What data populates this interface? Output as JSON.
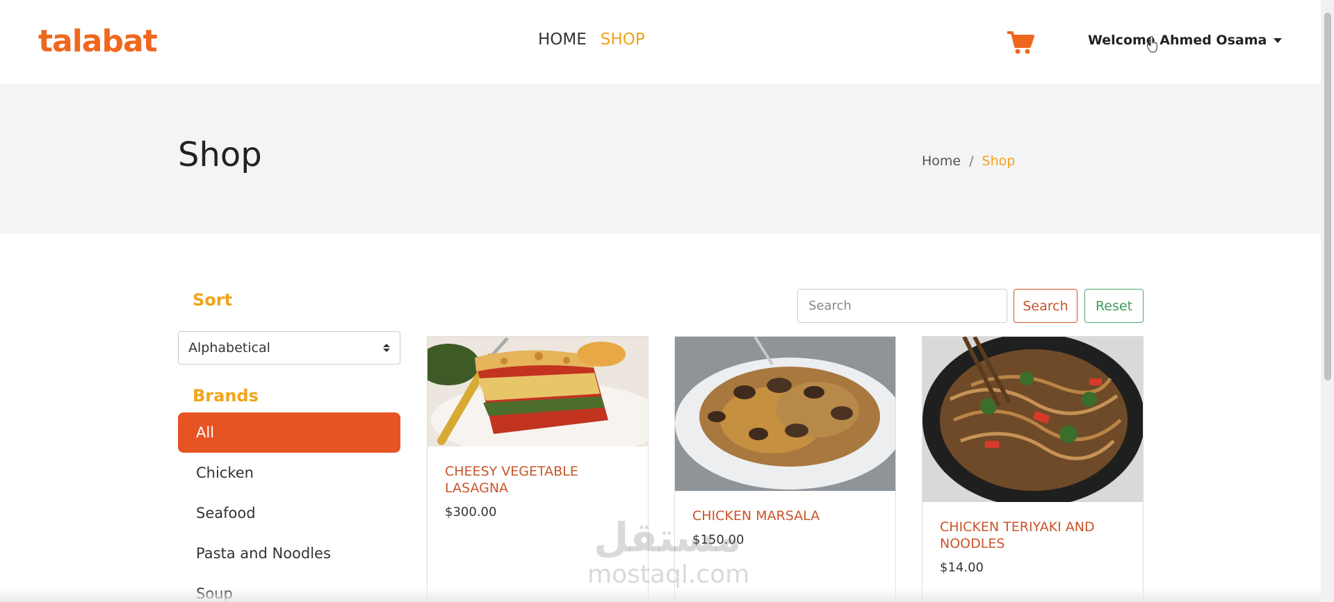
{
  "brand": {
    "logo": "talabat",
    "accent_color": "#f0671e"
  },
  "nav": {
    "links": [
      {
        "label": "HOME",
        "active": false
      },
      {
        "label": "SHOP",
        "active": true
      }
    ],
    "cart_icon": "shopping-cart-icon",
    "user_label": "Welcome Ahmed Osama"
  },
  "hero": {
    "title": "Shop",
    "breadcrumb": {
      "home": "Home",
      "separator": "/",
      "current": "Shop"
    }
  },
  "sidebar": {
    "sort_heading": "Sort",
    "sort_selected": "Alphabetical",
    "brands_heading": "Brands",
    "brands": [
      {
        "label": "All",
        "active": true
      },
      {
        "label": "Chicken",
        "active": false
      },
      {
        "label": "Seafood",
        "active": false
      },
      {
        "label": "Pasta and Noodles",
        "active": false
      },
      {
        "label": "Soup",
        "active": false
      }
    ]
  },
  "search": {
    "placeholder": "Search",
    "search_label": "Search",
    "reset_label": "Reset"
  },
  "products": [
    {
      "name": "Cheesy Vegetable Lasagna",
      "price": "$300.00"
    },
    {
      "name": "Chicken Marsala",
      "price": "$150.00"
    },
    {
      "name": "Chicken Teriyaki and Noodles",
      "price": "$14.00"
    }
  ],
  "watermark": {
    "arabic": "مستقل",
    "latin": "mostaql.com"
  }
}
